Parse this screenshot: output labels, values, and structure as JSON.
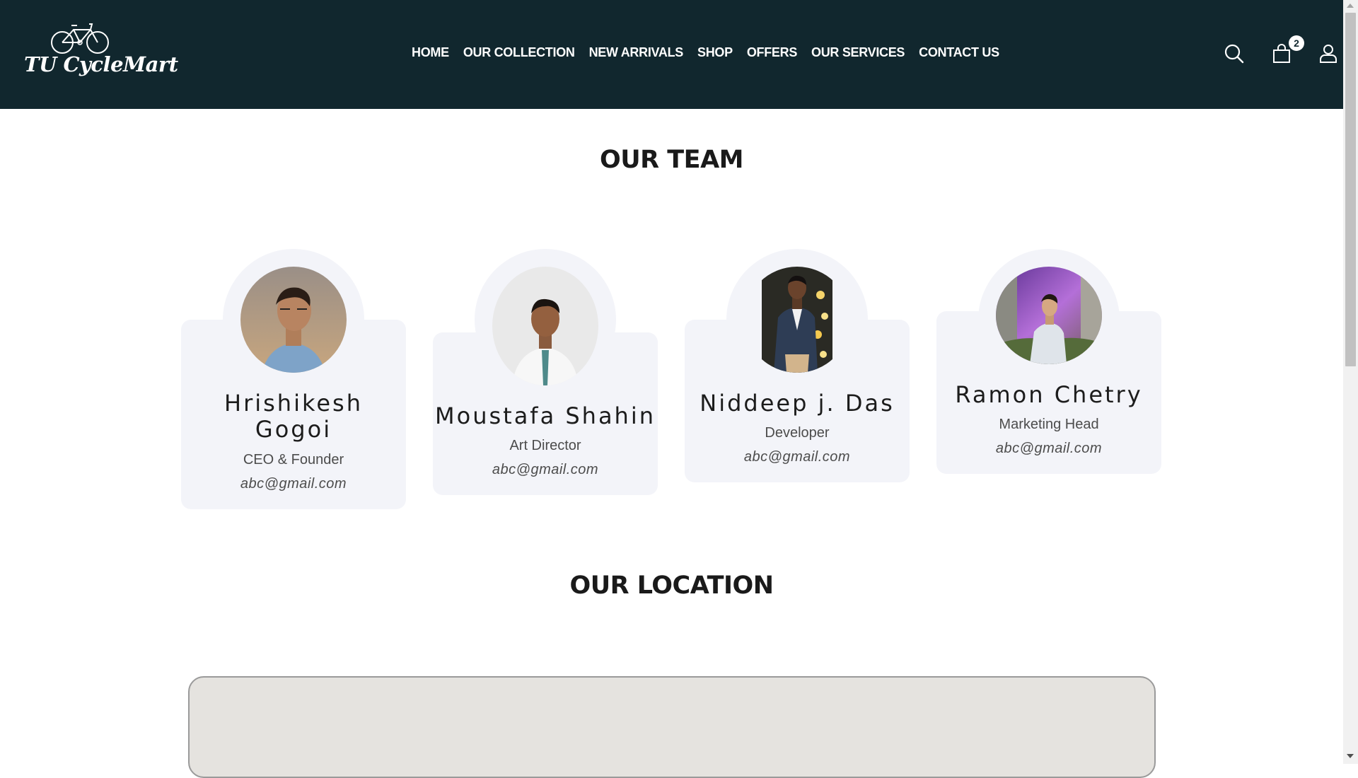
{
  "brand": {
    "logo_text": "TU CycleMart"
  },
  "nav": {
    "items": [
      "HOME",
      "OUR COLLECTION",
      "NEW ARRIVALS",
      "SHOP",
      "OFFERS",
      "OUR SERVICES",
      "CONTACT US"
    ]
  },
  "header_icons": {
    "search": "search-icon",
    "cart": "shopping-bag-icon",
    "user": "user-icon",
    "cart_count": "2"
  },
  "team": {
    "title": "OUR TEAM",
    "members": [
      {
        "name_line1": "Hrishikesh",
        "name_line2": "Gogoi",
        "role": "CEO & Founder",
        "email": "abc@gmail.com"
      },
      {
        "name_line1": "Moustafa Shahin",
        "name_line2": "",
        "role": "Art Director",
        "email": "abc@gmail.com"
      },
      {
        "name_line1": "Niddeep j. Das",
        "name_line2": "",
        "role": "Developer",
        "email": "abc@gmail.com"
      },
      {
        "name_line1": "Ramon Chetry",
        "name_line2": "",
        "role": "Marketing Head",
        "email": "abc@gmail.com"
      }
    ]
  },
  "location": {
    "title": "OUR LOCATION"
  },
  "colors": {
    "header_bg": "#11272e",
    "card_bg": "#f3f4f9",
    "map_bg": "#e5e3df"
  }
}
